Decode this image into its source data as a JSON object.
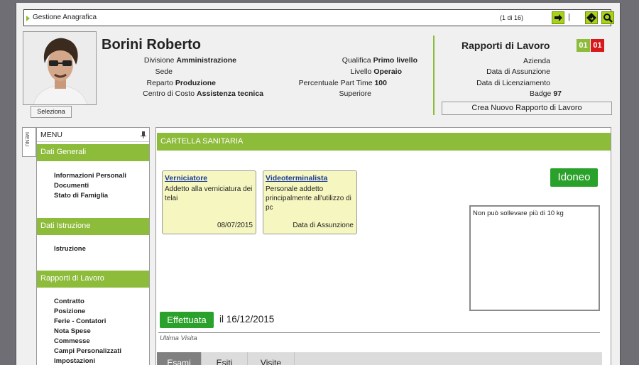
{
  "topbar": {
    "title": "Gestione Anagrafica",
    "count": "(1 di 16)",
    "separator": "|"
  },
  "profile": {
    "name": "Borini Roberto",
    "select_label": "Seleziona",
    "fields_left": [
      {
        "label": "Divisione",
        "value": "Amministrazione"
      },
      {
        "label": "Sede",
        "value": ""
      },
      {
        "label": "Reparto",
        "value": "Produzione"
      },
      {
        "label": "Centro di Costo",
        "value": "Assistenza tecnica"
      }
    ],
    "fields_mid": [
      {
        "label": "Qualifica",
        "value": "Primo livello"
      },
      {
        "label": "Livello",
        "value": "Operaio"
      },
      {
        "label": "Percentuale Part Time",
        "value": "100"
      },
      {
        "label": "Superiore",
        "value": ""
      }
    ]
  },
  "rapporti": {
    "title": "Rapporti di Lavoro",
    "badge_active": "01",
    "badge_total": "01",
    "badge_colors": {
      "active": "#8dbb3a",
      "total": "#d7191c"
    },
    "fields": [
      {
        "label": "Azienda",
        "value": ""
      },
      {
        "label": "Data di Assunzione",
        "value": ""
      },
      {
        "label": "Data di Licenziamento",
        "value": ""
      },
      {
        "label": "Badge",
        "value": "97"
      }
    ],
    "new_button": "Crea Nuovo Rapporto di Lavoro"
  },
  "menu": {
    "strip_label": "MENU",
    "header": "MENU",
    "sections": [
      {
        "title": "Dati Generali",
        "items": [
          "Informazioni Personali",
          "Documenti",
          "Stato di Famiglia"
        ]
      },
      {
        "title": "Dati Istruzione",
        "items": [
          "Istruzione"
        ]
      },
      {
        "title": "Rapporti di Lavoro",
        "items": [
          "Contratto",
          "Posizione",
          "Ferie - Contatori",
          "Nota Spese",
          "Commesse",
          "Campi Personalizzati",
          "Impostazioni"
        ]
      }
    ]
  },
  "cartella": {
    "title": "CARTELLA SANITARIA",
    "cards": [
      {
        "title": "Verniciatore",
        "desc": "Addetto alla verniciatura dei telai",
        "footer": "08/07/2015"
      },
      {
        "title": "Videoterminalista",
        "desc": "Personale addetto principalmente all'utilizzo di pc",
        "footer": "Data di Assunzione"
      }
    ],
    "status": "Idoneo",
    "note": "Non può sollevare più di 10 kg",
    "visit_status": "Effettuata",
    "visit_date": "il 16/12/2015",
    "visit_label": "Ultima Visita",
    "tabs": [
      "Esami",
      "Esiti",
      "Visite"
    ],
    "accent_color": "#8dbb3a",
    "success_color": "#2aa12a"
  }
}
